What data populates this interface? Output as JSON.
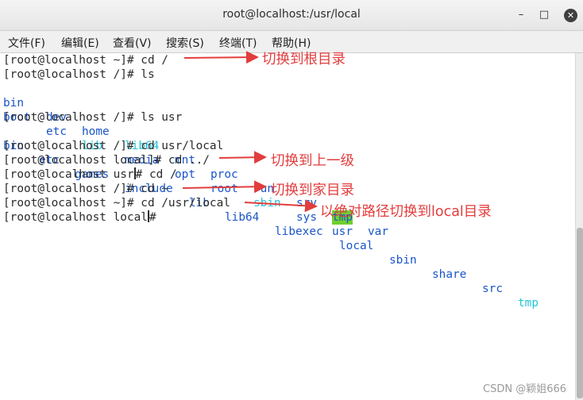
{
  "window": {
    "title": "root@localhost:/usr/local",
    "minimize": "–",
    "maximize": "□",
    "close": "✕"
  },
  "menu": [
    "文件(F)",
    "编辑(E)",
    "查看(V)",
    "搜索(S)",
    "终端(T)",
    "帮助(H)"
  ],
  "terminal": {
    "l1": "[root@localhost ~]# cd /",
    "l2": "[root@localhost /]# ls",
    "ls_root_row1": [
      "bin",
      "dev",
      "home",
      "lib64",
      "mnt",
      "proc",
      "run",
      "srv",
      "tmp",
      "var"
    ],
    "ls_root_row2": [
      "boot",
      "etc",
      "lib",
      "media",
      "opt",
      "root",
      "sbin",
      "sys",
      "usr"
    ],
    "l5": "[root@localhost /]# ls usr",
    "ls_usr": [
      "bin",
      "etc",
      "games",
      "include",
      "lib",
      "lib64",
      "libexec",
      "local",
      "sbin",
      "share",
      "src",
      "tmp"
    ],
    "l7": "[root@localhost /]# cd usr/local",
    "l8": "[root@localhost local]# cd ../",
    "l9a": "[root@localhost usr",
    "l9b": "# cd /",
    "l10": "[root@localhost /]# cd ~",
    "l11": "[root@localhost ~]# cd /usr/local",
    "l12a": "[root@localhost local",
    "l12b": "#"
  },
  "colors": {
    "dir": "#1a56c8",
    "link": "#22c5d8",
    "highlight": "#6fcf2f",
    "annotation": "#e23d3d"
  },
  "annotations": {
    "a1": "切换到根目录",
    "a2": "切换到上一级",
    "a3": "切换到家目录",
    "a4": "以绝对路径切换到local目录"
  },
  "watermark": "CSDN @颖姐666"
}
